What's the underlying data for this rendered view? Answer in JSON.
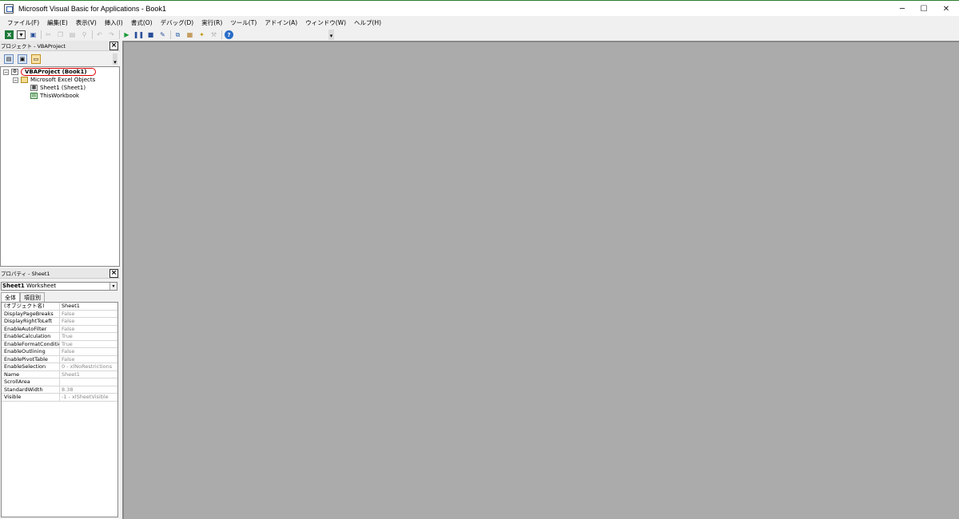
{
  "window": {
    "title": "Microsoft Visual Basic for Applications - Book1",
    "minimize_glyph": "─",
    "maximize_glyph": "☐",
    "close_glyph": "✕"
  },
  "menu": [
    "ファイル(F)",
    "編集(E)",
    "表示(V)",
    "挿入(I)",
    "書式(O)",
    "デバッグ(D)",
    "実行(R)",
    "ツール(T)",
    "アドイン(A)",
    "ウィンドウ(W)",
    "ヘルプ(H)"
  ],
  "toolbar": {
    "icons": [
      "excel-icon",
      "insert-module-icon",
      "save-icon",
      "cut-icon",
      "copy-icon",
      "paste-icon",
      "find-icon",
      "undo-icon",
      "redo-icon",
      "run-icon",
      "break-icon",
      "reset-icon",
      "design-mode-icon",
      "project-explorer-icon",
      "properties-icon",
      "object-browser-icon",
      "toolbox-icon",
      "help-icon"
    ]
  },
  "project_pane": {
    "title": "プロジェクト - VBAProject",
    "tree": {
      "root": "VBAProject (Book1)",
      "folder": "Microsoft Excel Objects",
      "items": [
        "Sheet1 (Sheet1)",
        "ThisWorkbook"
      ]
    }
  },
  "properties_pane": {
    "title": "プロパティ - Sheet1",
    "object_name": "Sheet1",
    "object_type": "Worksheet",
    "tabs": [
      "全体",
      "項目別"
    ],
    "rows": [
      {
        "name": "(オブジェクト名)",
        "value": "Sheet1"
      },
      {
        "name": "DisplayPageBreaks",
        "value": "False"
      },
      {
        "name": "DisplayRightToLeft",
        "value": "False"
      },
      {
        "name": "EnableAutoFilter",
        "value": "False"
      },
      {
        "name": "EnableCalculation",
        "value": "True"
      },
      {
        "name": "EnableFormatConditionsCalculation",
        "value": "True"
      },
      {
        "name": "EnableOutlining",
        "value": "False"
      },
      {
        "name": "EnablePivotTable",
        "value": "False"
      },
      {
        "name": "EnableSelection",
        "value": "0 - xlNoRestrictions"
      },
      {
        "name": "Name",
        "value": "Sheet1"
      },
      {
        "name": "ScrollArea",
        "value": ""
      },
      {
        "name": "StandardWidth",
        "value": "8.38"
      },
      {
        "name": "Visible",
        "value": "-1 - xlSheetVisible"
      }
    ]
  }
}
